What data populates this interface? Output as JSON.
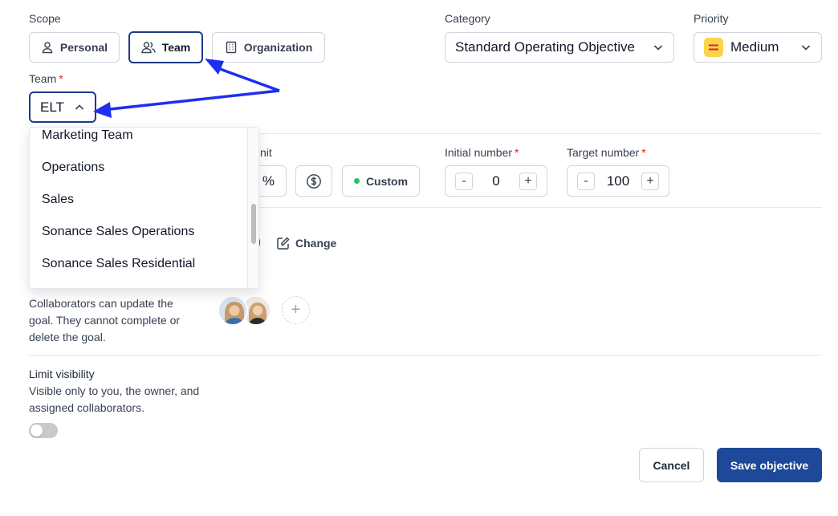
{
  "scope": {
    "label": "Scope",
    "options": [
      {
        "label": "Personal",
        "icon": "user-icon"
      },
      {
        "label": "Team",
        "icon": "users-icon",
        "selected": true
      },
      {
        "label": "Organization",
        "icon": "building-icon"
      }
    ]
  },
  "category": {
    "label": "Category",
    "value": "Standard Operating Objective"
  },
  "priority": {
    "label": "Priority",
    "value": "Medium",
    "icon_color": "#fcd34d",
    "icon_line_color": "#dc2626"
  },
  "team": {
    "label": "Team",
    "required": "*",
    "value": "ELT"
  },
  "team_dropdown": {
    "items": [
      "Marketing Team",
      "Operations",
      "Sales",
      "Sonance Sales Operations",
      "Sonance Sales Residential"
    ]
  },
  "unit": {
    "label_fragment": "nit",
    "percent_symbol": "%",
    "custom_label": "Custom",
    "custom_dot_color": "#22c55e"
  },
  "initial_number": {
    "label": "Initial number",
    "required": "*",
    "value": "0",
    "minus": "-",
    "plus": "+"
  },
  "target_number": {
    "label": "Target number",
    "required": "*",
    "value": "100",
    "minus": "-",
    "plus": "+"
  },
  "owner": {
    "change_label": "Change"
  },
  "collaborators": {
    "description": "Collaborators can update the goal. They cannot complete or delete the goal.",
    "add_symbol": "+"
  },
  "visibility": {
    "label": "Limit visibility",
    "description": "Visible only to you, the owner, and assigned collaborators.",
    "enabled": false
  },
  "footer": {
    "cancel_label": "Cancel",
    "save_label": "Save objective",
    "save_color": "#1e4899"
  },
  "annotation": {
    "arrow_color": "#1d2ff0"
  }
}
